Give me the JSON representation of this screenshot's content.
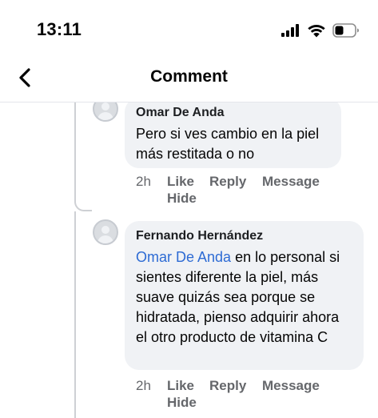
{
  "status_bar": {
    "time": "13:11",
    "icons": [
      "signal-icon",
      "wifi-icon",
      "battery-icon"
    ]
  },
  "nav": {
    "back_icon": "chevron-left-icon",
    "title": "Comment"
  },
  "comments": [
    {
      "author": "Omar De Anda",
      "text": "Pero si ves cambio en la piel más restitada o no",
      "time": "2h",
      "like": "Like",
      "reply": "Reply",
      "message": "Message",
      "hide": "Hide"
    },
    {
      "author": "Fernando Hernández",
      "mention": "Omar De Anda",
      "text": " en lo personal si sientes diferente la piel, más suave quizás sea porque se hidratada, pienso adquirir ahora el otro producto de vitamina C",
      "time": "2h",
      "like": "Like",
      "reply": "Reply",
      "message": "Message",
      "hide": "Hide"
    }
  ],
  "colors": {
    "bubble": "#f0f2f5",
    "mention": "#2d6bd4",
    "meta": "#65676b",
    "thread_line": "#ced0d4"
  }
}
